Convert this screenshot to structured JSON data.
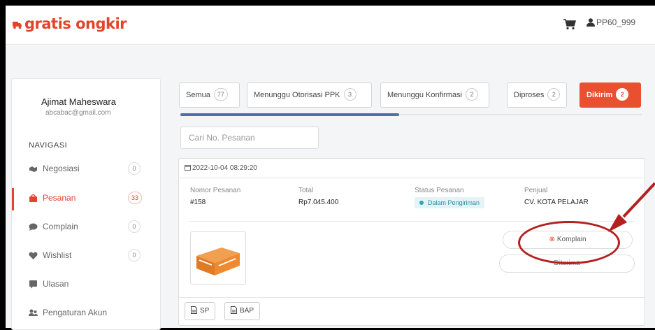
{
  "header": {
    "logo_text": "gratis ongkir",
    "username": "PP60_999",
    "brand_color": "#e2432b",
    "icons": [
      "truck-icon",
      "cart-icon",
      "user-icon"
    ]
  },
  "sidebar": {
    "user_name": "Ajimat Maheswara",
    "user_email": "abcabac@gmail.com",
    "nav_title": "NAVIGASI",
    "items": [
      {
        "label": "Negosiasi",
        "count": "0",
        "icon": "handshake-icon"
      },
      {
        "label": "Pesanan",
        "count": "33",
        "icon": "bag-icon",
        "active": true
      },
      {
        "label": "Complain",
        "count": "0",
        "icon": "chat-icon"
      },
      {
        "label": "Wishlist",
        "count": "0",
        "icon": "heart-icon"
      },
      {
        "label": "Ulasan",
        "icon": "review-icon"
      },
      {
        "label": "Pengaturan Akun",
        "icon": "users-icon"
      }
    ]
  },
  "tabs": [
    {
      "label": "Semua",
      "count": "77"
    },
    {
      "label": "Menunggu Otorisasi PPK",
      "count": "3"
    },
    {
      "label": "Menunggu Konfirmasi",
      "count": "2"
    },
    {
      "label": "Diproses",
      "count": "2"
    },
    {
      "label": "Dikirim",
      "count": "2",
      "active": true
    }
  ],
  "search": {
    "placeholder": "Cari No. Pesanan"
  },
  "order": {
    "date": "2022-10-04 08:29:20",
    "number_label": "Nomor Pesanan",
    "number": "#158",
    "total_label": "Total",
    "total": "Rp7.045.400",
    "status_label": "Status Pesanan",
    "status": "Dalam Pengiriman",
    "seller_label": "Penjual",
    "seller": "CV. KOTA PELAJAR",
    "komplain_label": "Komplain",
    "second_label": "Diterima",
    "docs": [
      "SP",
      "BAP"
    ]
  }
}
